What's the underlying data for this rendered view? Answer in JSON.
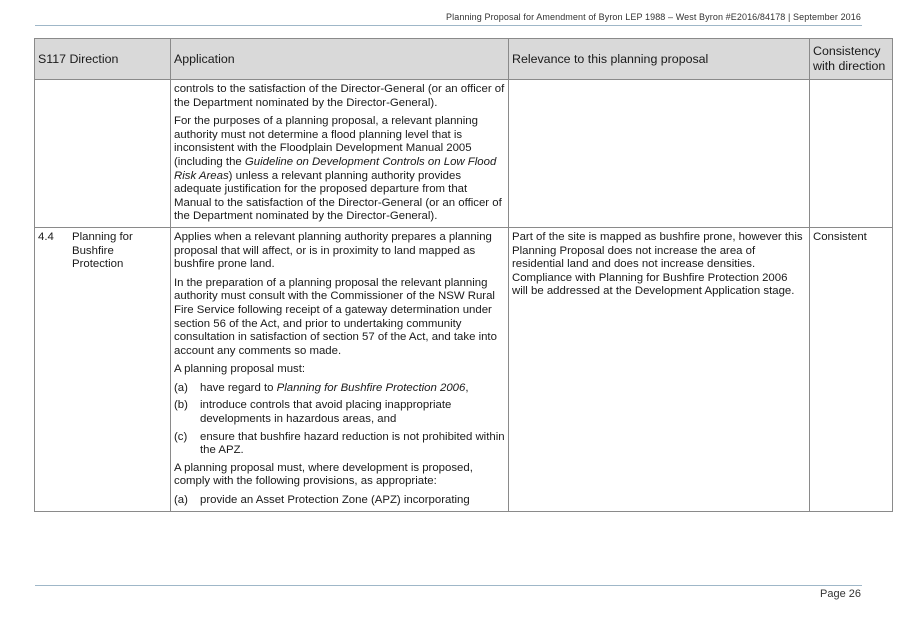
{
  "header": {
    "text": "Planning Proposal for Amendment of Byron LEP 1988 – West Byron #E2016/84178 | September 2016"
  },
  "table": {
    "headers": [
      "S117 Direction",
      "Application",
      "Relevance to this planning proposal",
      "Consistency with direction"
    ],
    "row1": {
      "application": [
        "controls to the satisfaction of the Director-General (or an officer of the Department nominated by the Director-General).",
        "For the purposes of a planning proposal, a relevant planning authority must not determine a flood planning level that is inconsistent with the Floodplain Development Manual 2005 (including the Guideline on Development Controls on Low Flood Risk Areas) unless a relevant planning authority provides adequate justification for the proposed departure from that Manual to the satisfaction of the Director-General (or an officer of the Department nominated by the Director-General)."
      ],
      "p2_parts": [
        "For the purposes of a planning proposal, a relevant planning authority must not determine a flood planning level that is inconsistent with the Floodplain Development Manual 2005 (including the ",
        "Guideline on Development Controls on Low Flood Risk Areas",
        ") unless a relevant planning authority provides adequate justification for the proposed departure from that Manual to the satisfaction of the Director-General (or an officer of the Department nominated by the Director-General)."
      ]
    },
    "row2": {
      "direction_number": "4.4",
      "direction_name": "Planning for Bushfire Protection",
      "application": {
        "p1": "Applies when a relevant planning authority prepares a planning proposal that will affect, or is in proximity to land mapped as bushfire prone land.",
        "p2": "In the preparation of a planning proposal the relevant planning authority must consult with the Commissioner of the NSW Rural Fire Service following receipt of a gateway determination under section 56 of the Act, and prior to undertaking community consultation in satisfaction of section 57 of the Act, and take into account any comments so made.",
        "p3": "A planning proposal must:",
        "list1": [
          {
            "label": "(a)",
            "pre": "have regard to ",
            "italic": "Planning for Bushfire Protection 2006",
            "post": ","
          },
          {
            "label": "(b)",
            "text": "introduce controls that avoid placing inappropriate developments in hazardous areas, and"
          },
          {
            "label": "(c)",
            "text": "ensure that bushfire hazard reduction is not prohibited within the APZ."
          }
        ],
        "p4": "A planning proposal must, where development is proposed, comply with the following provisions, as appropriate:",
        "list2": [
          {
            "label": "(a)",
            "text": "provide an Asset Protection Zone (APZ) incorporating"
          }
        ]
      },
      "relevance": "Part of the site is mapped as bushfire prone, however this Planning Proposal does not increase the area of residential land and does not increase densities. Compliance with Planning for Bushfire Protection 2006 will be addressed at the Development Application stage.",
      "consistency": "Consistent"
    }
  },
  "footer": {
    "page": "Page 26"
  }
}
